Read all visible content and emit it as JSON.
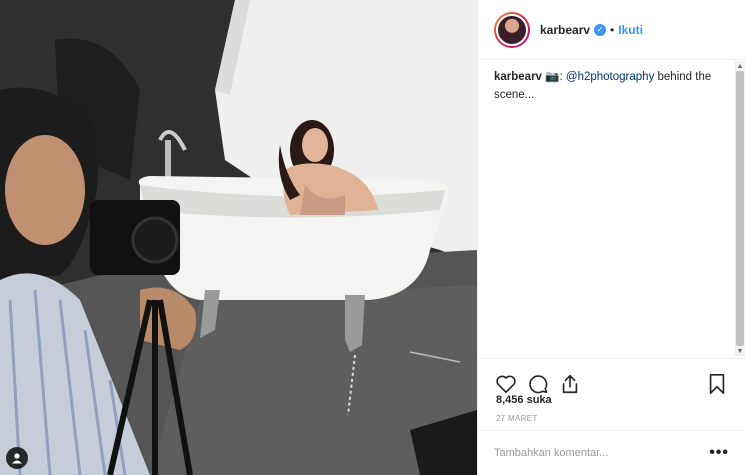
{
  "post": {
    "image_alt": "behind the scenes photo",
    "tag_icon": "person-tag-icon"
  },
  "header": {
    "username": "karbearv",
    "verified_icon": "verified-badge-icon",
    "separator": "•",
    "follow_label": "Ikuti"
  },
  "caption": {
    "username": "karbearv",
    "camera_emoji": "📷",
    "separator": ":",
    "mention": "@h2photography",
    "text": "behind the scene..."
  },
  "actions": {
    "icons": [
      "heart-icon",
      "comment-icon",
      "share-icon",
      "bookmark-icon"
    ]
  },
  "likes": "8,456 suka",
  "date": "27 MARET",
  "comment": {
    "placeholder": "Tambahkan komentar...",
    "more_label": "•••"
  },
  "colors": {
    "link": "#3897f0",
    "mention": "#003569",
    "text": "#262626",
    "muted": "#999999"
  }
}
